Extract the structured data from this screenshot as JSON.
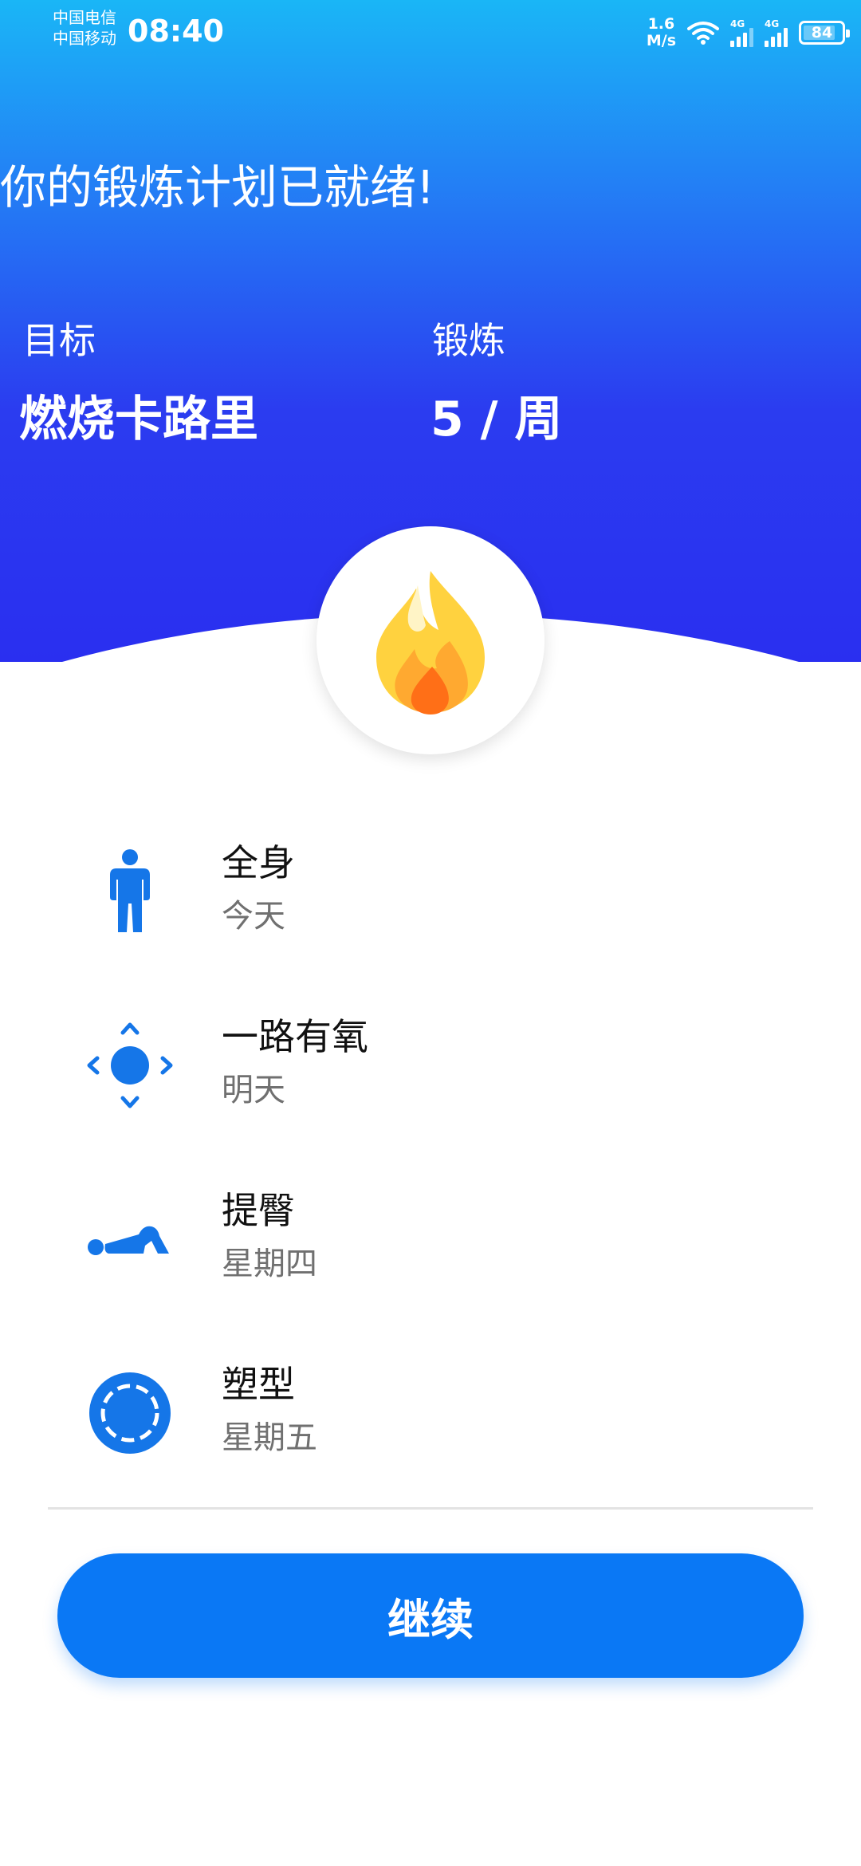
{
  "status_bar": {
    "carrier_1": "中国电信",
    "carrier_2": "中国移动",
    "time": "08:40",
    "speed_value": "1.6",
    "speed_unit": "M/s",
    "network_1": "4G",
    "network_2": "4G",
    "battery": "84",
    "battery_level": 0.84
  },
  "header": {
    "title": "你的锻炼计划已就绪!",
    "goal_label": "目标",
    "goal_value": "燃烧卡路里",
    "workout_label": "锻炼",
    "workout_value": "5 / 周"
  },
  "hero_icon": "flame-icon",
  "plan_items": [
    {
      "icon": "person-icon",
      "title": "全身",
      "day": "今天"
    },
    {
      "icon": "dpad-icon",
      "title": "一路有氧",
      "day": "明天"
    },
    {
      "icon": "glute-bridge-icon",
      "title": "提臀",
      "day": "星期四"
    },
    {
      "icon": "dashed-circle-icon",
      "title": "塑型",
      "day": "星期五"
    }
  ],
  "continue_label": "继续",
  "colors": {
    "accent": "#0a78f5",
    "header_top": "#1ab6f6",
    "header_bottom": "#2a2ff0",
    "icon_blue": "#1576e8",
    "flame_yellow": "#ffd23f",
    "flame_orange": "#ff8a1f"
  }
}
